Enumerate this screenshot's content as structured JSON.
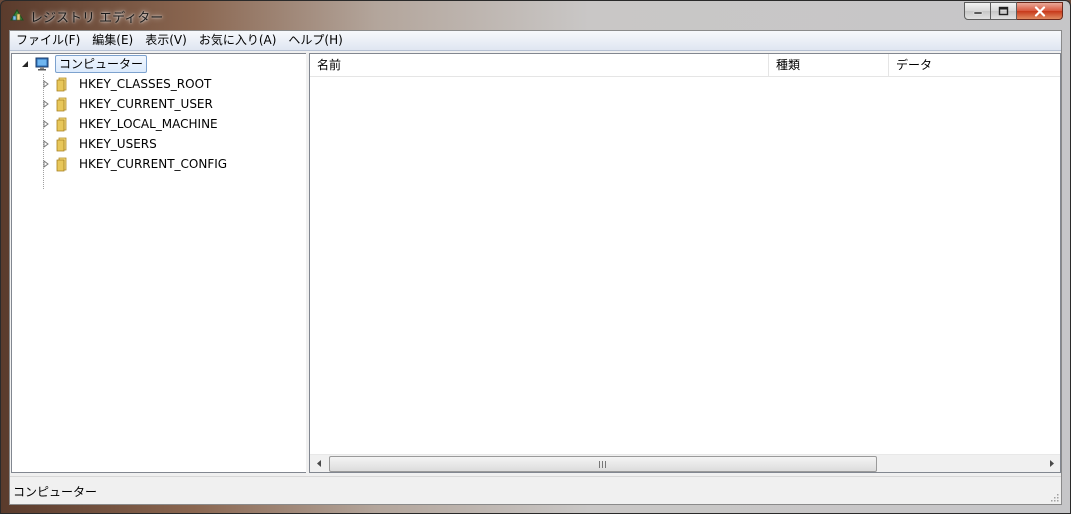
{
  "window": {
    "title": "レジストリ エディター",
    "title_icon": "registry-editor-icon",
    "controls": {
      "minimize": "minimize-icon",
      "maximize": "maximize-icon",
      "close": "close-icon"
    }
  },
  "menu": [
    {
      "label": "ファイル(F)"
    },
    {
      "label": "編集(E)"
    },
    {
      "label": "表示(V)"
    },
    {
      "label": "お気に入り(A)"
    },
    {
      "label": "ヘルプ(H)"
    }
  ],
  "tree": {
    "root": {
      "label": "コンピューター",
      "icon": "computer-icon",
      "expanded": true,
      "selected": true
    },
    "children": [
      {
        "label": "HKEY_CLASSES_ROOT",
        "icon": "folder-icon"
      },
      {
        "label": "HKEY_CURRENT_USER",
        "icon": "folder-icon"
      },
      {
        "label": "HKEY_LOCAL_MACHINE",
        "icon": "folder-icon"
      },
      {
        "label": "HKEY_USERS",
        "icon": "folder-icon"
      },
      {
        "label": "HKEY_CURRENT_CONFIG",
        "icon": "folder-icon"
      }
    ]
  },
  "list": {
    "columns": [
      {
        "label": "名前"
      },
      {
        "label": "種類"
      },
      {
        "label": "データ"
      }
    ],
    "rows": []
  },
  "status": {
    "text": "コンピューター"
  },
  "colors": {
    "selection_border": "#7da2ce",
    "folder": "#e8c75a",
    "close_button": "#c7381a"
  }
}
